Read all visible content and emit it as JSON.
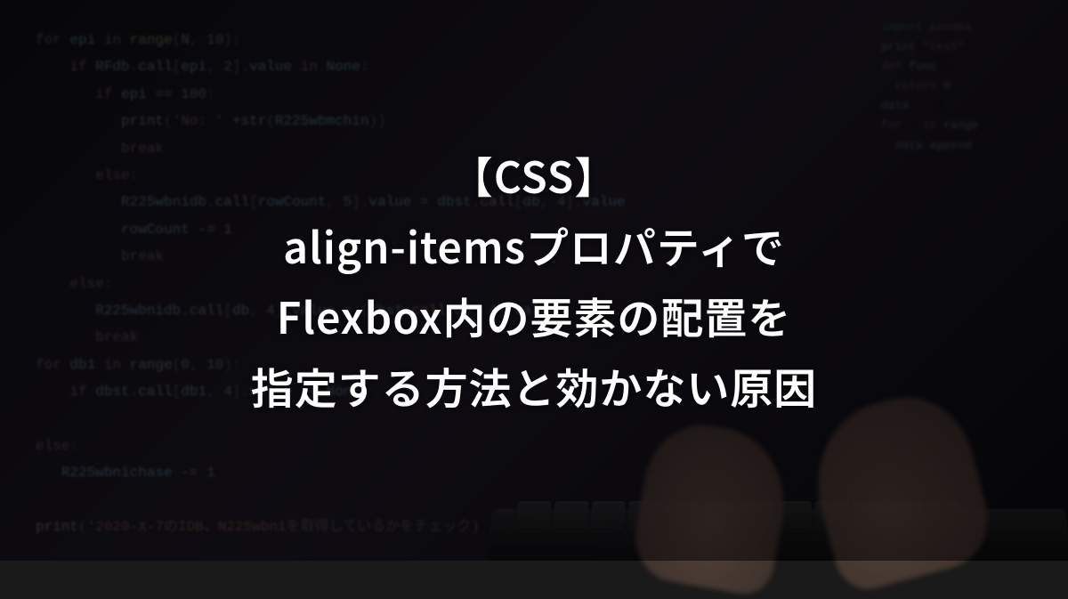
{
  "title": {
    "line1": "【CSS】",
    "line2": "align-itemsプロパティで",
    "line3": "Flexbox内の要素の配置を",
    "line4": "指定する方法と効かない原因"
  }
}
